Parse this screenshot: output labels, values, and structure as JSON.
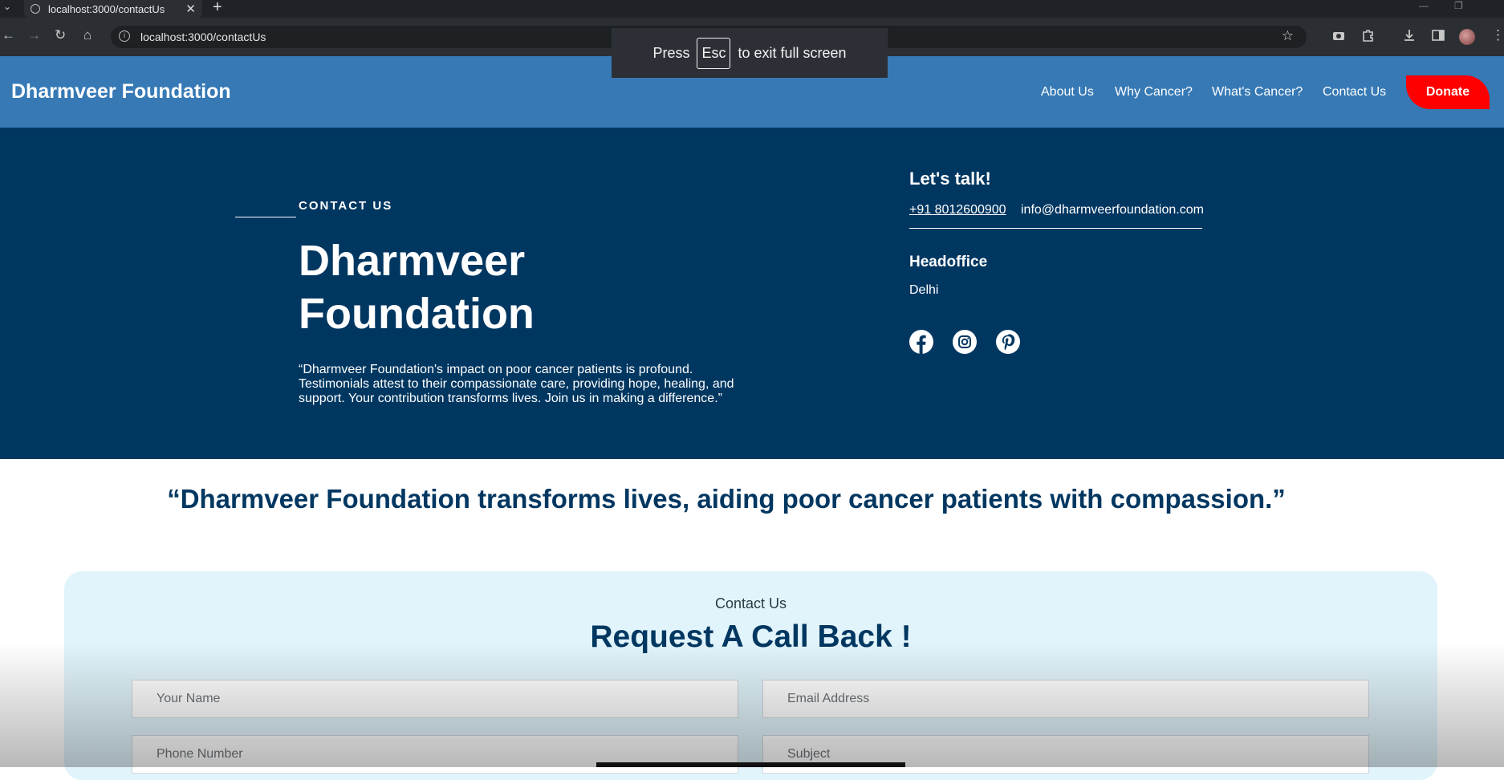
{
  "browser": {
    "tab_title": "localhost:3000/contactUs",
    "tab_close": "✕",
    "new_tab": "+",
    "url": "localhost:3000/contactUs",
    "fullscreen_msg_pre": "Press",
    "fullscreen_key": "Esc",
    "fullscreen_msg_post": "to exit full screen"
  },
  "header": {
    "brand": "Dharmveer Foundation",
    "nav": [
      "About Us",
      "Why Cancer?",
      "What's Cancer?",
      "Contact Us"
    ],
    "donate": "Donate"
  },
  "hero": {
    "kicker": "CONTACT US",
    "title_line1": "Dharmveer",
    "title_line2": "Foundation",
    "quote": "“Dharmveer Foundation's impact on poor cancer patients is profound. Testimonials attest to their compassionate care, providing hope, healing, and support. Your contribution transforms lives. Join us in making a difference.”",
    "talk_heading": "Let's talk!",
    "phone": "+91 8012600900",
    "email": "info@dharmveerfoundation.com",
    "office_heading": "Headoffice",
    "office_city": "Delhi",
    "social": [
      "facebook-icon",
      "instagram-icon",
      "pinterest-icon"
    ]
  },
  "banner": {
    "quote": "“Dharmveer Foundation transforms lives, aiding poor cancer patients with compassion.”"
  },
  "form": {
    "subtitle": "Contact Us",
    "title": "Request A Call Back !",
    "name_placeholder": "Your Name",
    "email_placeholder": "Email Address",
    "phone_placeholder": "Phone Number",
    "subject_placeholder": "Subject"
  },
  "colors": {
    "header_bg": "#3679b5",
    "hero_bg": "#003761",
    "donate_bg": "#ff0000",
    "card_bg": "#e1f4fb"
  }
}
